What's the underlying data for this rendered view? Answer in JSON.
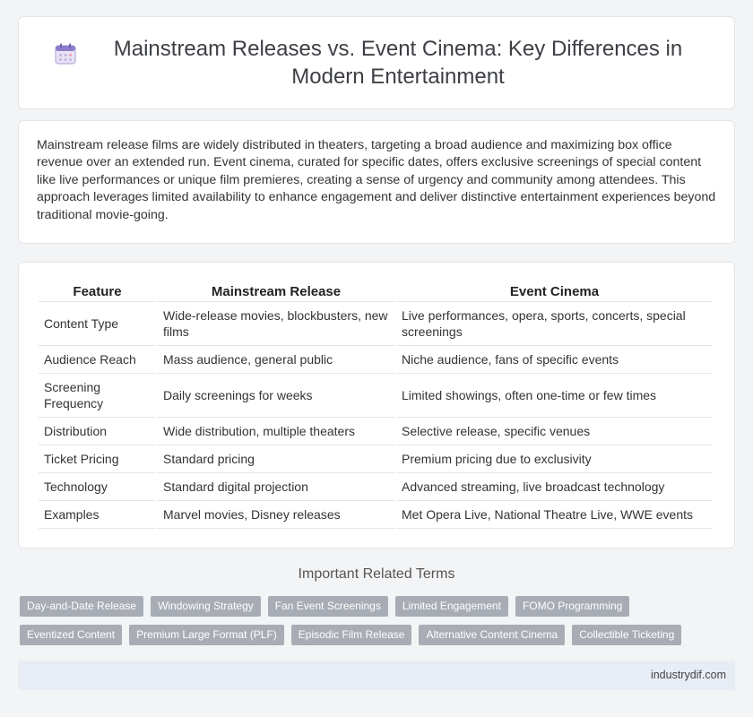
{
  "header": {
    "icon": "calendar-icon",
    "title": "Mainstream Releases vs. Event Cinema: Key Differences in Modern Entertainment"
  },
  "intro": {
    "text": "Mainstream release films are widely distributed in theaters, targeting a broad audience and maximizing box office revenue over an extended run. Event cinema, curated for specific dates, offers exclusive screenings of special content like live performances or unique film premieres, creating a sense of urgency and community among attendees. This approach leverages limited availability to enhance engagement and deliver distinctive entertainment experiences beyond traditional movie-going."
  },
  "table": {
    "headers": [
      "Feature",
      "Mainstream Release",
      "Event Cinema"
    ],
    "rows": [
      [
        "Content Type",
        "Wide-release movies, blockbusters, new films",
        "Live performances, opera, sports, concerts, special screenings"
      ],
      [
        "Audience Reach",
        "Mass audience, general public",
        "Niche audience, fans of specific events"
      ],
      [
        "Screening Frequency",
        "Daily screenings for weeks",
        "Limited showings, often one-time or few times"
      ],
      [
        "Distribution",
        "Wide distribution, multiple theaters",
        "Selective release, specific venues"
      ],
      [
        "Ticket Pricing",
        "Standard pricing",
        "Premium pricing due to exclusivity"
      ],
      [
        "Technology",
        "Standard digital projection",
        "Advanced streaming, live broadcast technology"
      ],
      [
        "Examples",
        "Marvel movies, Disney releases",
        "Met Opera Live, National Theatre Live, WWE events"
      ]
    ]
  },
  "related": {
    "title": "Important Related Terms",
    "tags": [
      "Day-and-Date Release",
      "Windowing Strategy",
      "Fan Event Screenings",
      "Limited Engagement",
      "FOMO Programming",
      "Eventized Content",
      "Premium Large Format (PLF)",
      "Episodic Film Release",
      "Alternative Content Cinema",
      "Collectible Ticketing"
    ]
  },
  "footer": {
    "site": "industrydif.com"
  },
  "colors": {
    "tag_bg": "#a8adb5",
    "footer_bg": "#e8edf5",
    "page_bg": "#f3f4f6"
  }
}
